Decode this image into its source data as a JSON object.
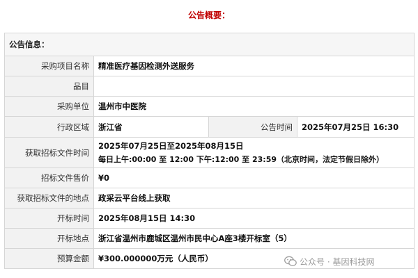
{
  "title": "公告概要：",
  "section": "公告信息：",
  "fields": {
    "project_name": {
      "label": "采购项目名称",
      "value": "精准医疗基因检测外送服务"
    },
    "category": {
      "label": "品目",
      "value": ""
    },
    "purchaser": {
      "label": "采购单位",
      "value": "温州市中医院"
    },
    "region": {
      "label": "行政区域",
      "value": "浙江省"
    },
    "announce_time": {
      "label": "公告时间",
      "value": "2025年07月25日 16:30"
    },
    "doc_time": {
      "label": "获取招标文件时间",
      "value": "2025年07月25日至2025年08月15日",
      "value2": "每日上午:00:00 至 12:00  下午:12:00 至 23:59（北京时间，法定节假日除外）"
    },
    "doc_price": {
      "label": "招标文件售价",
      "value": "¥0"
    },
    "doc_location": {
      "label": "获取招标文件的地点",
      "value": "政采云平台线上获取"
    },
    "open_time": {
      "label": "开标时间",
      "value": "2025年08月15日 14:30"
    },
    "open_location": {
      "label": "开标地点",
      "value": "浙江省温州市鹿城区温州市民中心A座3楼开标室（5）"
    },
    "budget": {
      "label": "预算金额",
      "value": "¥300.000000万元（人民币）"
    }
  },
  "watermark": {
    "text": "公众号 · 基因科技网"
  }
}
